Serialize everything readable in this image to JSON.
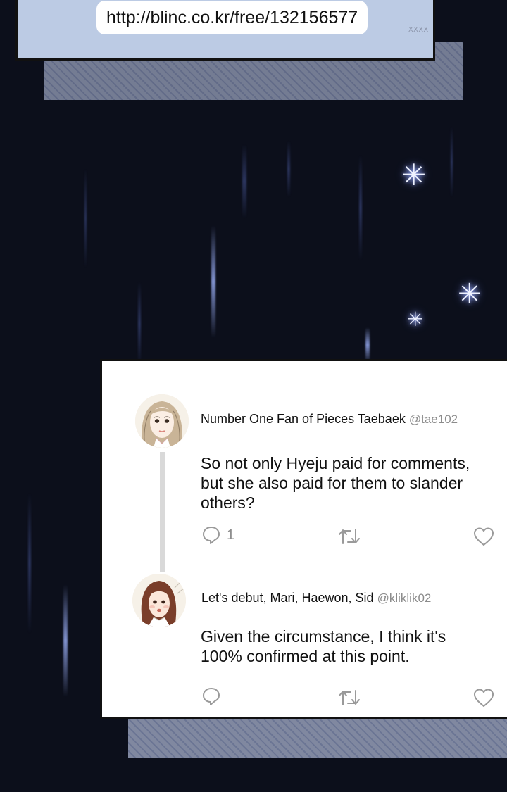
{
  "chat": {
    "url_text": "http://blinc.co.kr/free/132156577",
    "time_text": "XXXX"
  },
  "comments": [
    {
      "author": "Number One Fan of Pieces Taebaek",
      "handle": "@tae102",
      "text": "So not only Hyeju paid for comments, but she also paid for them to slander others?",
      "reply_count": "1",
      "avatar": "avatar-woman-long-hair"
    },
    {
      "author": "Let's debut, Mari, Haewon, Sid",
      "handle": "@kliklik02",
      "text": "Given the circumstance, I think it's 100% confirmed at this point.",
      "reply_count": "",
      "avatar": "avatar-woman-brown-hair"
    }
  ],
  "icons": {
    "reply": "speech-bubble-icon",
    "retweet": "retweet-icon",
    "like": "heart-icon"
  },
  "colors": {
    "background": "#0c0f1b",
    "chat_panel": "#bccbe4",
    "card": "#ffffff",
    "muted_text": "#8b8b8b"
  }
}
